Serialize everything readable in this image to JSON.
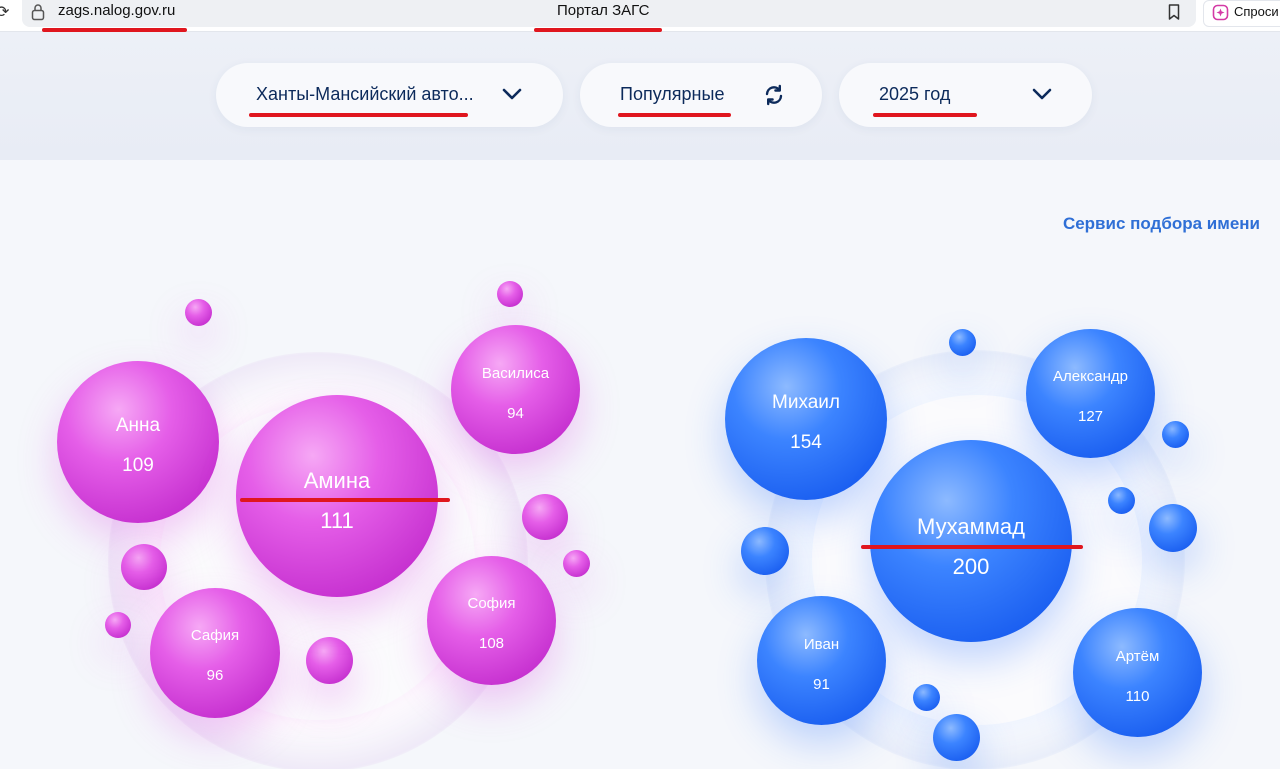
{
  "browser": {
    "url": "zags.nalog.gov.ru",
    "page_title": "Портал ЗАГС",
    "ask_label": "Спроси"
  },
  "filters": {
    "region": "Ханты-Мансийский авто...",
    "sort": "Популярные",
    "year": "2025 год"
  },
  "service_link": "Сервис подбора имени",
  "girls": [
    {
      "name": "Амина",
      "count": "111"
    },
    {
      "name": "Анна",
      "count": "109"
    },
    {
      "name": "Василиса",
      "count": "94"
    },
    {
      "name": "Сафия",
      "count": "96"
    },
    {
      "name": "София",
      "count": "108"
    }
  ],
  "boys": [
    {
      "name": "Мухаммад",
      "count": "200"
    },
    {
      "name": "Михаил",
      "count": "154"
    },
    {
      "name": "Александр",
      "count": "127"
    },
    {
      "name": "Иван",
      "count": "91"
    },
    {
      "name": "Артём",
      "count": "110"
    }
  ],
  "colors": {
    "girl_accent": "#e05ae6",
    "boy_accent": "#2f74ff",
    "link": "#2f6fd6",
    "annotation": "#e0161e"
  }
}
